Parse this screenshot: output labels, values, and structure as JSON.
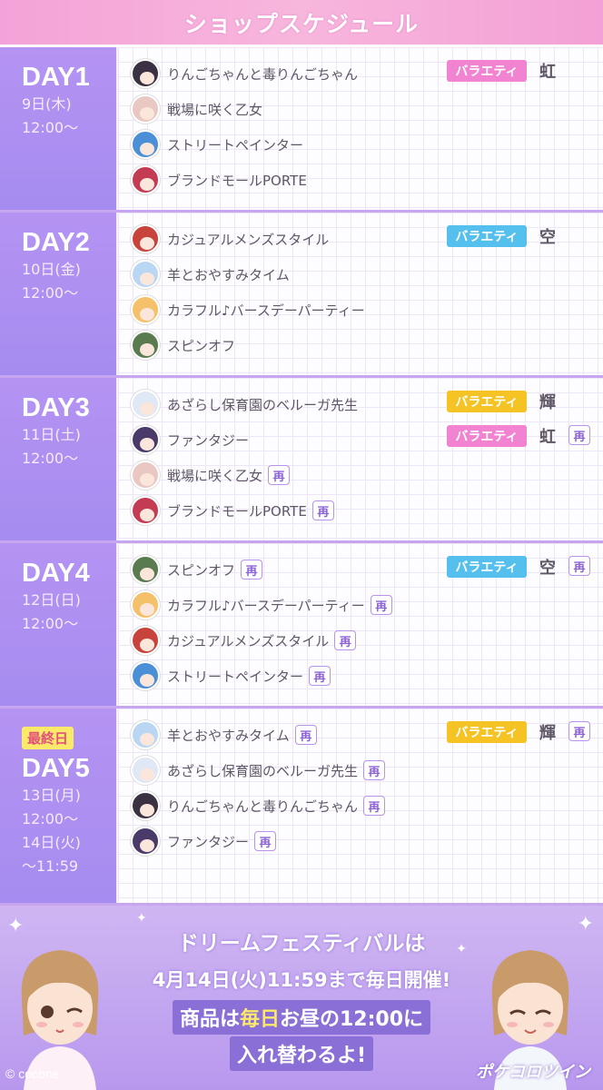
{
  "header": {
    "title": "ショップスケジュール"
  },
  "labels": {
    "re": "再",
    "final": "最終日"
  },
  "days": [
    {
      "label": "DAY1",
      "dates": [
        "9日(木)",
        "12:00〜"
      ],
      "items": [
        {
          "name": "りんごちゃんと毒りんごちゃん",
          "re": false,
          "avatar_color": "#3a3142"
        },
        {
          "name": "戦場に咲く乙女",
          "re": false,
          "avatar_color": "#e9c7c3"
        },
        {
          "name": "ストリートペインター",
          "re": false,
          "avatar_color": "#4b8fd6"
        },
        {
          "name": "ブランドモールPORTE",
          "re": false,
          "avatar_color": "#c43c54"
        }
      ],
      "tags": [
        {
          "label": "バラエティ",
          "color": "#f283d0",
          "kind": "虹",
          "re": false
        }
      ]
    },
    {
      "label": "DAY2",
      "dates": [
        "10日(金)",
        "12:00〜"
      ],
      "items": [
        {
          "name": "カジュアルメンズスタイル",
          "re": false,
          "avatar_color": "#c8433c"
        },
        {
          "name": "羊とおやすみタイム",
          "re": false,
          "avatar_color": "#b9d7f3"
        },
        {
          "name": "カラフル♪バースデーパーティー",
          "re": false,
          "avatar_color": "#f5c06a"
        },
        {
          "name": "スピンオフ",
          "re": false,
          "avatar_color": "#5a7b4f"
        }
      ],
      "tags": [
        {
          "label": "バラエティ",
          "color": "#55c0ee",
          "kind": "空",
          "re": false
        }
      ]
    },
    {
      "label": "DAY3",
      "dates": [
        "11日(土)",
        "12:00〜"
      ],
      "items": [
        {
          "name": "あざらし保育園のベルーガ先生",
          "re": false,
          "avatar_color": "#dfe8f4"
        },
        {
          "name": "ファンタジー",
          "re": false,
          "avatar_color": "#4a3a6a"
        },
        {
          "name": "戦場に咲く乙女",
          "re": true,
          "avatar_color": "#e9c7c3"
        },
        {
          "name": "ブランドモールPORTE",
          "re": true,
          "avatar_color": "#c43c54"
        }
      ],
      "tags": [
        {
          "label": "バラエティ",
          "color": "#f5c324",
          "kind": "輝",
          "re": false
        },
        {
          "label": "バラエティ",
          "color": "#f283d0",
          "kind": "虹",
          "re": true
        }
      ]
    },
    {
      "label": "DAY4",
      "dates": [
        "12日(日)",
        "12:00〜"
      ],
      "items": [
        {
          "name": "スピンオフ",
          "re": true,
          "avatar_color": "#5a7b4f"
        },
        {
          "name": "カラフル♪バースデーパーティー",
          "re": true,
          "avatar_color": "#f5c06a"
        },
        {
          "name": "カジュアルメンズスタイル",
          "re": true,
          "avatar_color": "#c8433c"
        },
        {
          "name": "ストリートペインター",
          "re": true,
          "avatar_color": "#4b8fd6"
        }
      ],
      "tags": [
        {
          "label": "バラエティ",
          "color": "#55c0ee",
          "kind": "空",
          "re": true
        }
      ]
    },
    {
      "label": "DAY5",
      "final": true,
      "dates": [
        "13日(月)",
        "12:00〜",
        "14日(火)",
        "〜11:59"
      ],
      "items": [
        {
          "name": "羊とおやすみタイム",
          "re": true,
          "avatar_color": "#b9d7f3"
        },
        {
          "name": "あざらし保育園のベルーガ先生",
          "re": true,
          "avatar_color": "#dfe8f4"
        },
        {
          "name": "りんごちゃんと毒りんごちゃん",
          "re": true,
          "avatar_color": "#3a3142"
        },
        {
          "name": "ファンタジー",
          "re": true,
          "avatar_color": "#4a3a6a"
        }
      ],
      "tags": [
        {
          "label": "バラエティ",
          "color": "#f5c324",
          "kind": "輝",
          "re": true
        }
      ]
    }
  ],
  "footer": {
    "line1": "ドリームフェスティバルは",
    "line2": "4月14日(火)11:59まで毎日開催!",
    "line3_a": "商品は",
    "line3_b": "毎日",
    "line3_c": "お昼の12:00に",
    "line4": "入れ替わるよ!",
    "copyright": "© cocone",
    "logo": "ポケコロツイン"
  },
  "colors": {
    "accent_purple": "#a68cf0",
    "header_pink": "#f4a3d8",
    "tag_pink": "#f283d0",
    "tag_blue": "#55c0ee",
    "tag_yellow": "#f5c324"
  }
}
